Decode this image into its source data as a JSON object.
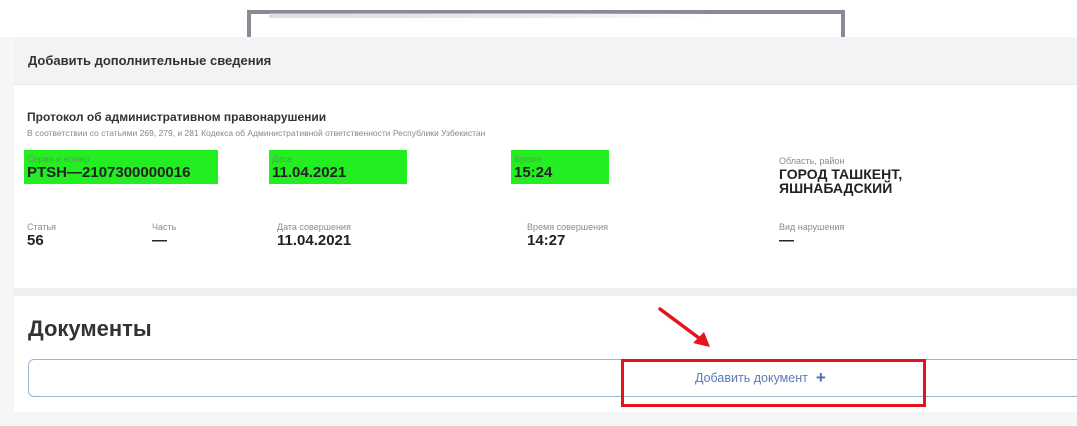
{
  "header": {
    "title": "Добавить дополнительные сведения"
  },
  "protocol": {
    "title": "Протокол об административном правонарушении",
    "subtitle": "В соответствии со статьями 269, 279, и 281 Кодекса об Административной ответственности Республики Узбекистан"
  },
  "fields": {
    "series": {
      "label": "Серия и номер",
      "value": "PTSH—2107300000016"
    },
    "date": {
      "label": "Дата",
      "value": "11.04.2021"
    },
    "time": {
      "label": "Время",
      "value": "15:24"
    },
    "region": {
      "label": "Область, район",
      "value_line1": "ГОРОД ТАШКЕНТ,",
      "value_line2": "ЯШНАБАДСКИЙ"
    },
    "article": {
      "label": "Статья",
      "value": "56"
    },
    "part": {
      "label": "Часть",
      "value": "—"
    },
    "commit_date": {
      "label": "Дата совершения",
      "value": "11.04.2021"
    },
    "commit_time": {
      "label": "Время совершения",
      "value": "14:27"
    },
    "violation_type": {
      "label": "Вид нарушения",
      "value": "—"
    }
  },
  "documents": {
    "title": "Документы",
    "add_button_label": "Добавить документ",
    "add_icon": "+"
  },
  "colors": {
    "highlight": "#22ee22",
    "annotation_red": "#e3141c",
    "link_blue": "#5b7bb4"
  }
}
